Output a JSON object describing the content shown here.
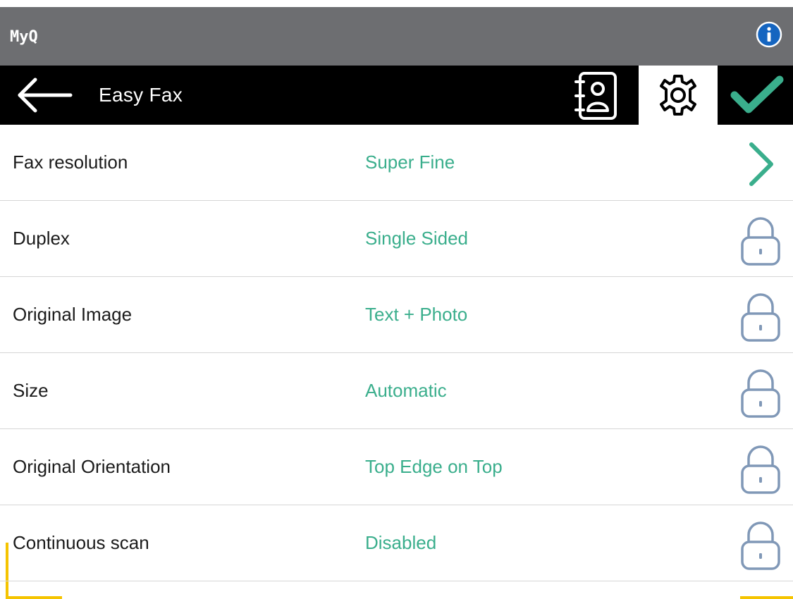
{
  "header": {
    "app_title": "MyQ",
    "info_icon": "info-icon",
    "brand_color": "#3aae8c",
    "bar_color": "#6d6e71",
    "corner_color": "#f5c400"
  },
  "navbar": {
    "back_icon": "back-arrow-icon",
    "title": "Easy Fax",
    "address_book_icon": "address-book-icon",
    "settings_icon": "gear-icon",
    "settings_selected": true,
    "confirm_icon": "checkmark-icon"
  },
  "settings": [
    {
      "label": "Fax resolution",
      "value": "Super Fine",
      "icon": "chevron-right-icon",
      "locked": false
    },
    {
      "label": "Duplex",
      "value": "Single Sided",
      "icon": "lock-icon",
      "locked": true
    },
    {
      "label": "Original Image",
      "value": "Text + Photo",
      "icon": "lock-icon",
      "locked": true
    },
    {
      "label": "Size",
      "value": "Automatic",
      "icon": "lock-icon",
      "locked": true
    },
    {
      "label": "Original Orientation",
      "value": "Top Edge on Top",
      "icon": "lock-icon",
      "locked": true
    },
    {
      "label": "Continuous scan",
      "value": "Disabled",
      "icon": "lock-icon",
      "locked": true
    }
  ]
}
